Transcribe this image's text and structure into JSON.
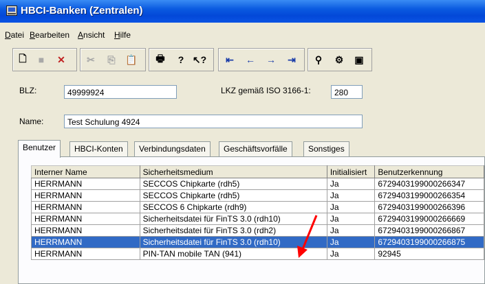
{
  "window": {
    "title": "HBCI-Banken (Zentralen)"
  },
  "menu": [
    {
      "label": "Datei"
    },
    {
      "label": "Bearbeiten"
    },
    {
      "label": "Ansicht"
    },
    {
      "label": "Hilfe"
    }
  ],
  "toolbar": {
    "icons": [
      "new-document-icon",
      "save-icon",
      "delete-icon",
      "cut-icon",
      "copy-icon",
      "paste-icon",
      "print-icon",
      "help-icon",
      "context-help-icon",
      "first-record-icon",
      "previous-record-icon",
      "next-record-icon",
      "last-record-icon",
      "search-icon",
      "tools-icon",
      "window-icon"
    ]
  },
  "form": {
    "blz_label": "BLZ:",
    "blz_value": "49999924",
    "lkz_label": "LKZ gemäß ISO 3166-1:",
    "lkz_value": "280",
    "name_label": "Name:",
    "name_value": "Test Schulung 4924"
  },
  "tabs": [
    {
      "label": "Benutzer",
      "active": true
    },
    {
      "label": "HBCI-Konten",
      "active": false
    },
    {
      "label": "Verbindungsdaten",
      "active": false
    },
    {
      "label": "Geschäftsvorfälle",
      "active": false
    },
    {
      "label": "Sonstiges",
      "active": false
    }
  ],
  "table": {
    "columns": [
      "Interner Name",
      "Sicherheitsmedium",
      "Initialisiert",
      "Benutzerkennung"
    ],
    "rows": [
      [
        "HERRMANN",
        "SECCOS Chipkarte (rdh5)",
        "Ja",
        "6729403199000266347"
      ],
      [
        "HERRMANN",
        "SECCOS Chipkarte (rdh5)",
        "Ja",
        "6729403199000266354"
      ],
      [
        "HERRMANN",
        "SECCOS 6 Chipkarte (rdh9)",
        "Ja",
        "6729403199000266396"
      ],
      [
        "HERRMANN",
        "Sicherheitsdatei für FinTS 3.0 (rdh10)",
        "Ja",
        "6729403199000266669"
      ],
      [
        "HERRMANN",
        "Sicherheitsdatei für FinTS 3.0 (rdh2)",
        "Ja",
        "6729403199000266867"
      ],
      [
        "HERRMANN",
        "Sicherheitsdatei für FinTS 3.0 (rdh10)",
        "Ja",
        "6729403199000266875"
      ],
      [
        "HERRMANN",
        "PIN-TAN mobile TAN (941)",
        "Ja",
        "92945"
      ]
    ],
    "selected_row": 5
  },
  "colors": {
    "selection": "#316ac5",
    "titlebar": "#0a54e4",
    "annotation_arrow": "#ff0000"
  }
}
